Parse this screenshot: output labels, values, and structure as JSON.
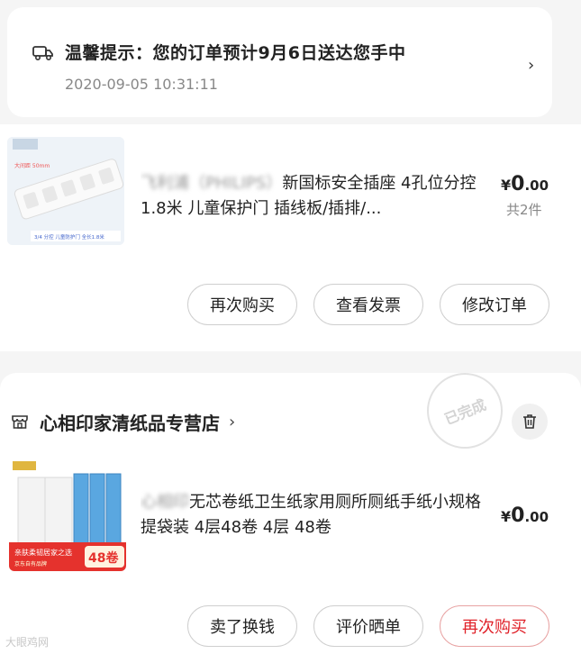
{
  "notice": {
    "title": "温馨提示：您的订单预计9月6日送达您手中",
    "time": "2020-09-05 10:31:11",
    "chevron": "›"
  },
  "order1": {
    "product_name_blurred": "飞利浦（PHILIPS）",
    "product_name": "新国标安全插座 4孔位分控 1.8米 儿童保护门 插线板/插排/...",
    "price_yuan": "¥",
    "price_int": "0",
    "price_dec": ".00",
    "count": "共2件",
    "thumb_texts": {
      "corner": "大间距\n50mm",
      "banner": "3/4 分控 儿童防护门 全长1.8米"
    },
    "buttons": [
      "再次购买",
      "查看发票",
      "修改订单"
    ]
  },
  "order2": {
    "store_name": "心相印家清纸品专营店",
    "store_chevron": "›",
    "stamp": "已完成",
    "product_name_blurred": "心相印",
    "product_name": "无芯卷纸卫生纸家用厕所厕纸手纸小规格提袋装 4层48卷 4层 48卷",
    "price_yuan": "¥",
    "price_int": "0",
    "price_dec": ".00",
    "thumb_texts": {
      "badge": "48卷",
      "slogan": "亲肤柔韧居家之选",
      "sub": "京东自有品牌"
    },
    "buttons": [
      "卖了换钱",
      "评价晒单",
      "再次购买"
    ]
  },
  "watermark": "大眼鸡网",
  "colors": {
    "accent_red": "#e0222a",
    "background": "#f5f5f5"
  },
  "icons": [
    "truck-icon",
    "chevron-right-icon",
    "store-icon",
    "trash-icon"
  ]
}
